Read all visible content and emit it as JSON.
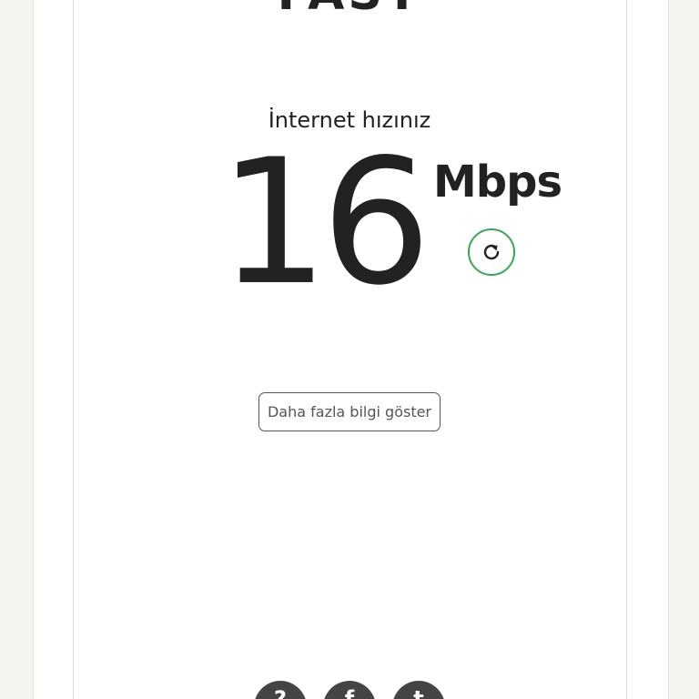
{
  "app": {
    "logo_text": "FAST"
  },
  "speed": {
    "label": "İnternet hızınız",
    "value": "16",
    "unit": "Mbps"
  },
  "actions": {
    "refresh_icon": "refresh-icon",
    "more_info_label": "Daha fazla bilgi göster"
  },
  "social": [
    {
      "icon": "help-icon",
      "glyph": "?"
    },
    {
      "icon": "facebook-icon",
      "glyph": "f"
    },
    {
      "icon": "twitter-icon",
      "glyph": "t"
    }
  ],
  "colors": {
    "page_background": "#f5f4f0",
    "panel_background": "#ffffff",
    "text": "#222222",
    "refresh_accent": "#35a852",
    "social_icon_background": "#444444"
  }
}
